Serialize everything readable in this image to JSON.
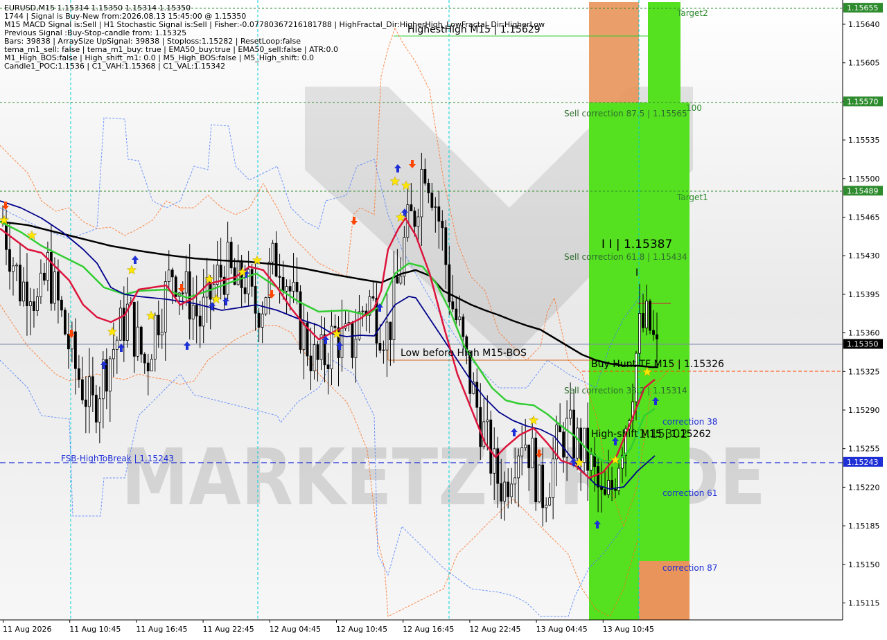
{
  "info_lines": [
    "EURUSD,M15  1.15314 1.15350 1.15314 1.15350",
    "1744  | Signal is Buy-New from:2026.08.13 15:45:00 @ 1.15350",
    "M15 MACD Signal is:Sell | H1 Stochastic Signal is:Sell | Fisher:-0.07780367216181788 | HighFractal_Dir:HigherHigh_LowFractal_Dir:HigherLow",
    "Previous Signal :Buy-Stop-candle from: 1.15325",
    "Bars: 39838 | ArraySize UpSignal: 39838 | Stoploss:1.15282 | ResetLoop:false",
    "tema_m1_sell: false | tema_m1_buy: true | EMA50_buy:true | EMA50_sell:false | ATR:0.0",
    "M1_High_BOS:false | High_shift_m1: 0.0 | M5_High_BOS:false | M5_High_shift: 0.0",
    "Candle1_POC:1.1536 | C1_VAH:1.15368 | C1_VAL:1.15342"
  ],
  "watermark": "MARKETZITRADE",
  "price_axis": {
    "ticks": [
      "1.15640",
      "1.15605",
      "1.15570",
      "1.15535",
      "1.15500",
      "1.15465",
      "1.15430",
      "1.15395",
      "1.15360",
      "1.15325",
      "1.15290",
      "1.15255",
      "1.15220",
      "1.15185",
      "1.15150",
      "1.15115"
    ],
    "tags": [
      {
        "label": "1.15655",
        "color": "#2e8b2e"
      },
      {
        "label": "1.15570",
        "color": "#2e8b2e"
      },
      {
        "label": "1.15489",
        "color": "#2e8b2e"
      },
      {
        "label": "1.15350",
        "color": "#000000"
      },
      {
        "label": "1.15243",
        "color": "#1e2fd6"
      }
    ]
  },
  "time_axis": [
    "11 Aug 2026",
    "11 Aug 10:45",
    "11 Aug 16:45",
    "11 Aug 22:45",
    "12 Aug 04:45",
    "12 Aug 10:45",
    "12 Aug 16:45",
    "12 Aug 22:45",
    "13 Aug 04:45",
    "13 Aug 10:45"
  ],
  "annotations": {
    "target2": "Target2",
    "target1": "Target1",
    "level_100": "100",
    "highest_high": "HighestHigh   M15 | 1.15629",
    "sell_corr_875": "Sell correction 87.5 | 1.15565",
    "sell_corr_618": "Sell correction 61.8 | 1.15434",
    "sell_corr_382": "Sell correction 38.2 | 1.15314",
    "peak_label": "I I | 1.15387",
    "peak_marker": "I",
    "low_before_high": "Low before High   M15-BOS",
    "buy_hunt": "Buy Hunt  TF M15 | 1.15326",
    "high_shift": "High-shift  M15 | 1.15262",
    "high_shift_overlap": "1.15302",
    "fsb": "FSB-HighToBreak | 1.15243",
    "corr_38": "correction 38",
    "corr_61": "correction 61",
    "corr_87": "correction 87"
  },
  "colors": {
    "bull_green": "#55e020",
    "bear_orange": "#e8945a",
    "ema_red": "#dc143c",
    "ema_green": "#32cd32",
    "ema_navy": "#00008b",
    "ema_black": "#000000",
    "level_green": "#2e8b2e",
    "level_blue": "#1e2fd6",
    "arrow_up": "#1e2fd6",
    "arrow_down": "#ff4500",
    "star": "#ffe600"
  },
  "chart_data": {
    "type": "candlestick",
    "symbol": "EURUSD",
    "timeframe": "M15",
    "ylim": [
      1.15095,
      1.15665
    ],
    "current_price": 1.1535,
    "levels": [
      {
        "name": "Target2",
        "price": 1.15655
      },
      {
        "name": "100",
        "price": 1.1557
      },
      {
        "name": "Target1",
        "price": 1.15489
      },
      {
        "name": "HighestHigh M15",
        "price": 1.15629
      },
      {
        "name": "Buy Hunt TF M15",
        "price": 1.15326
      },
      {
        "name": "High-shift M15",
        "price": 1.15262
      },
      {
        "name": "FSB-HighToBreak",
        "price": 1.15243
      }
    ],
    "series": [
      {
        "name": "close",
        "values": [
          1.1546,
          1.1543,
          1.154,
          1.1541,
          1.1538,
          1.1542,
          1.1539,
          1.1536,
          1.1533,
          1.1531,
          1.1529,
          1.1532,
          1.1534,
          1.1536,
          1.1538,
          1.1535,
          1.1533,
          1.1537,
          1.1539,
          1.1542,
          1.154,
          1.1539,
          1.1537,
          1.1539,
          1.1541,
          1.1542,
          1.154,
          1.1541,
          1.1538,
          1.1539,
          1.1542,
          1.1543,
          1.154,
          1.1537,
          1.1535,
          1.1533,
          1.1534,
          1.1536,
          1.1535,
          1.1535,
          1.1538,
          1.1539,
          1.1537,
          1.1536,
          1.154,
          1.1545,
          1.1547,
          1.1552,
          1.1549,
          1.1545,
          1.1539,
          1.1536,
          1.1532,
          1.1529,
          1.1526,
          1.1523,
          1.1522,
          1.1525,
          1.1527,
          1.1525,
          1.1521,
          1.1523,
          1.1526,
          1.1527,
          1.1526,
          1.1525,
          1.1523,
          1.152,
          1.1522,
          1.1526,
          1.153,
          1.1536,
          1.1537,
          1.1534
        ]
      }
    ]
  }
}
